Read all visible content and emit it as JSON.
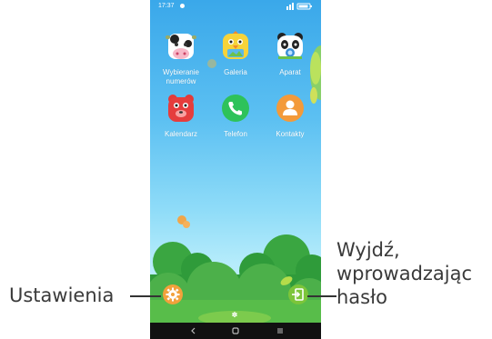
{
  "status_bar": {
    "time": "17:37"
  },
  "apps": [
    {
      "label_lines": [
        "Wybieranie",
        "numerów"
      ],
      "icon": "cow-dial-icon"
    },
    {
      "label_lines": [
        "Galeria"
      ],
      "icon": "chick-gallery-icon"
    },
    {
      "label_lines": [
        "Aparat"
      ],
      "icon": "panda-camera-icon"
    },
    {
      "label_lines": [
        "Kalendarz"
      ],
      "icon": "bear-calendar-icon"
    },
    {
      "label_lines": [
        "Telefon"
      ],
      "icon": "phone-icon"
    },
    {
      "label_lines": [
        "Kontakty"
      ],
      "icon": "contacts-icon"
    }
  ],
  "bottom_buttons": {
    "settings_icon": "gear-icon",
    "exit_icon": "exit-door-icon"
  },
  "nav": {
    "back": "back-icon",
    "home": "home-icon",
    "menu": "menu-icon"
  },
  "callouts": {
    "left": "Ustawienia",
    "right_lines": [
      "Wyjdź,",
      "wprowadzając",
      "hasło"
    ]
  },
  "colors": {
    "sky_top": "#3aa8ea",
    "bush_dark": "#2f9b3a",
    "bush_light": "#6cc24a",
    "fab_orange": "#f2a13b",
    "fab_green": "#7cc53a",
    "phone_green": "#2ec25a",
    "contacts_orange": "#f39a3a"
  }
}
